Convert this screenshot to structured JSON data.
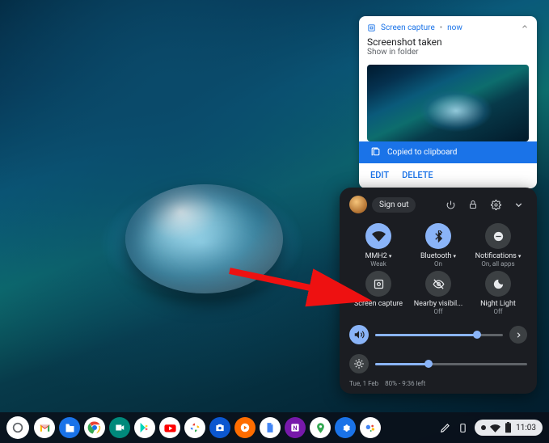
{
  "notification": {
    "app": "Screen capture",
    "time": "now",
    "title": "Screenshot taken",
    "subtitle": "Show in folder",
    "copied": "Copied to clipboard",
    "actions": {
      "edit": "EDIT",
      "delete": "DELETE"
    }
  },
  "panel": {
    "signout": "Sign out",
    "tiles": [
      {
        "label": "MMH2",
        "sub": "Weak",
        "caret": true
      },
      {
        "label": "Bluetooth",
        "sub": "On",
        "caret": true
      },
      {
        "label": "Notifications",
        "sub": "On, all apps",
        "caret": true
      },
      {
        "label": "Screen capture",
        "sub": ""
      },
      {
        "label": "Nearby visibil...",
        "sub": "Off"
      },
      {
        "label": "Night Light",
        "sub": "Off"
      }
    ],
    "volume_pct": 80,
    "brightness_pct": 35,
    "footer": {
      "date": "Tue, 1 Feb",
      "battery": "80% - 9:36 left"
    }
  },
  "tray": {
    "clock": "11:03",
    "icons": [
      "pen",
      "phone",
      "notif-dot",
      "wifi",
      "battery"
    ]
  },
  "apps": [
    {
      "name": "gmail",
      "bg": "#fff"
    },
    {
      "name": "files",
      "bg": "#1a73e8"
    },
    {
      "name": "chrome",
      "bg": "#fff"
    },
    {
      "name": "meet",
      "bg": "#00897b"
    },
    {
      "name": "play",
      "bg": "#fff"
    },
    {
      "name": "youtube",
      "bg": "#fff"
    },
    {
      "name": "photos",
      "bg": "#fff"
    },
    {
      "name": "camera",
      "bg": "#0b57d0"
    },
    {
      "name": "music",
      "bg": "#ff6d00"
    },
    {
      "name": "docs",
      "bg": "#fff"
    },
    {
      "name": "onenote",
      "bg": "#7719aa"
    },
    {
      "name": "maps",
      "bg": "#fff"
    },
    {
      "name": "settings",
      "bg": "#1a73e8"
    },
    {
      "name": "assistant",
      "bg": "#fff"
    }
  ]
}
